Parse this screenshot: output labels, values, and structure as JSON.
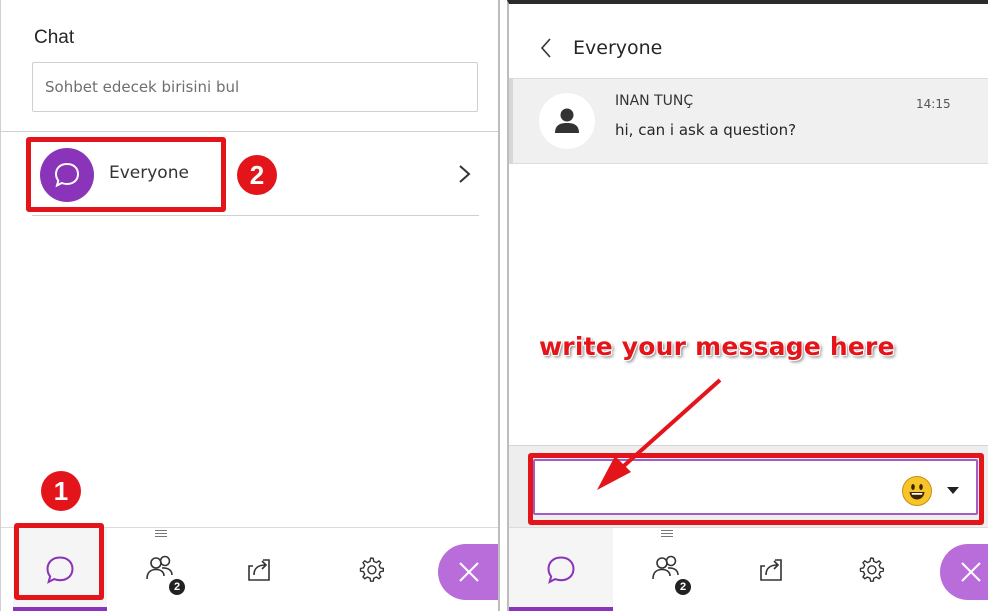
{
  "left_panel": {
    "title": "Chat",
    "search": {
      "placeholder": "Sohbet edecek birisini bul",
      "value": ""
    },
    "channels": [
      {
        "label": "Everyone"
      }
    ]
  },
  "right_panel": {
    "title": "Everyone",
    "messages": [
      {
        "sender": "INAN TUNÇ",
        "time": "14:15",
        "text": "hi, can i ask a question?"
      }
    ],
    "compose": {
      "value": ""
    }
  },
  "toolbar": {
    "participants_count": "2",
    "items": [
      "chat-icon",
      "participants-icon",
      "share-content-icon",
      "gear-icon",
      "close-icon"
    ]
  },
  "annotations": {
    "step1": "1",
    "step2": "2",
    "instruction": "write your message here"
  },
  "colors": {
    "accent_purple": "#8a35b9",
    "close_purple": "#b96ddb",
    "annotation_red": "#e3141a"
  }
}
